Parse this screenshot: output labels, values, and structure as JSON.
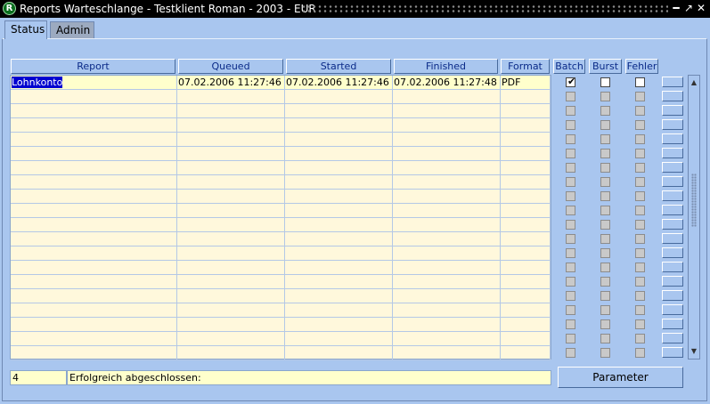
{
  "window": {
    "title": "Reports Warteschlange - Testklient Roman - 2003 - EUR",
    "icon_glyph": "R"
  },
  "tabs": [
    {
      "label": "Status",
      "active": true
    },
    {
      "label": "Admin",
      "active": false
    }
  ],
  "table": {
    "headers": {
      "report": "Report",
      "queued": "Queued",
      "started": "Started",
      "finished": "Finished",
      "format": "Format",
      "batch": "Batch",
      "burst": "Burst",
      "fehler": "Fehler"
    },
    "rows": [
      {
        "report": "Lohnkonto",
        "queued": "07.02.2006 11:27:46",
        "started": "07.02.2006 11:27:46",
        "finished": "07.02.2006 11:27:48",
        "format": "PDF",
        "batch": true,
        "burst": false,
        "fehler": false
      },
      {
        "report": "",
        "queued": "",
        "started": "",
        "finished": "",
        "format": ""
      },
      {
        "report": "",
        "queued": "",
        "started": "",
        "finished": "",
        "format": ""
      },
      {
        "report": "",
        "queued": "",
        "started": "",
        "finished": "",
        "format": ""
      },
      {
        "report": "",
        "queued": "",
        "started": "",
        "finished": "",
        "format": ""
      },
      {
        "report": "",
        "queued": "",
        "started": "",
        "finished": "",
        "format": ""
      },
      {
        "report": "",
        "queued": "",
        "started": "",
        "finished": "",
        "format": ""
      },
      {
        "report": "",
        "queued": "",
        "started": "",
        "finished": "",
        "format": ""
      },
      {
        "report": "",
        "queued": "",
        "started": "",
        "finished": "",
        "format": ""
      },
      {
        "report": "",
        "queued": "",
        "started": "",
        "finished": "",
        "format": ""
      },
      {
        "report": "",
        "queued": "",
        "started": "",
        "finished": "",
        "format": ""
      },
      {
        "report": "",
        "queued": "",
        "started": "",
        "finished": "",
        "format": ""
      },
      {
        "report": "",
        "queued": "",
        "started": "",
        "finished": "",
        "format": ""
      },
      {
        "report": "",
        "queued": "",
        "started": "",
        "finished": "",
        "format": ""
      },
      {
        "report": "",
        "queued": "",
        "started": "",
        "finished": "",
        "format": ""
      },
      {
        "report": "",
        "queued": "",
        "started": "",
        "finished": "",
        "format": ""
      },
      {
        "report": "",
        "queued": "",
        "started": "",
        "finished": "",
        "format": ""
      },
      {
        "report": "",
        "queued": "",
        "started": "",
        "finished": "",
        "format": ""
      },
      {
        "report": "",
        "queued": "",
        "started": "",
        "finished": "",
        "format": ""
      },
      {
        "report": "",
        "queued": "",
        "started": "",
        "finished": "",
        "format": ""
      }
    ]
  },
  "footer": {
    "count": "4",
    "status_text": "Erfolgreich abgeschlossen:",
    "parameter_label": "Parameter"
  },
  "icons": {
    "app": "oracle-forms-icon",
    "minimize": "minimize-icon",
    "maximize": "maximize-icon",
    "close": "close-icon",
    "scroll_up": "arrow-up-icon",
    "scroll_down": "arrow-down-icon"
  },
  "colors": {
    "background": "#a9c6ef",
    "grid": "#fff8dc",
    "selection": "#0000d0",
    "header_text": "#0a2a88"
  }
}
